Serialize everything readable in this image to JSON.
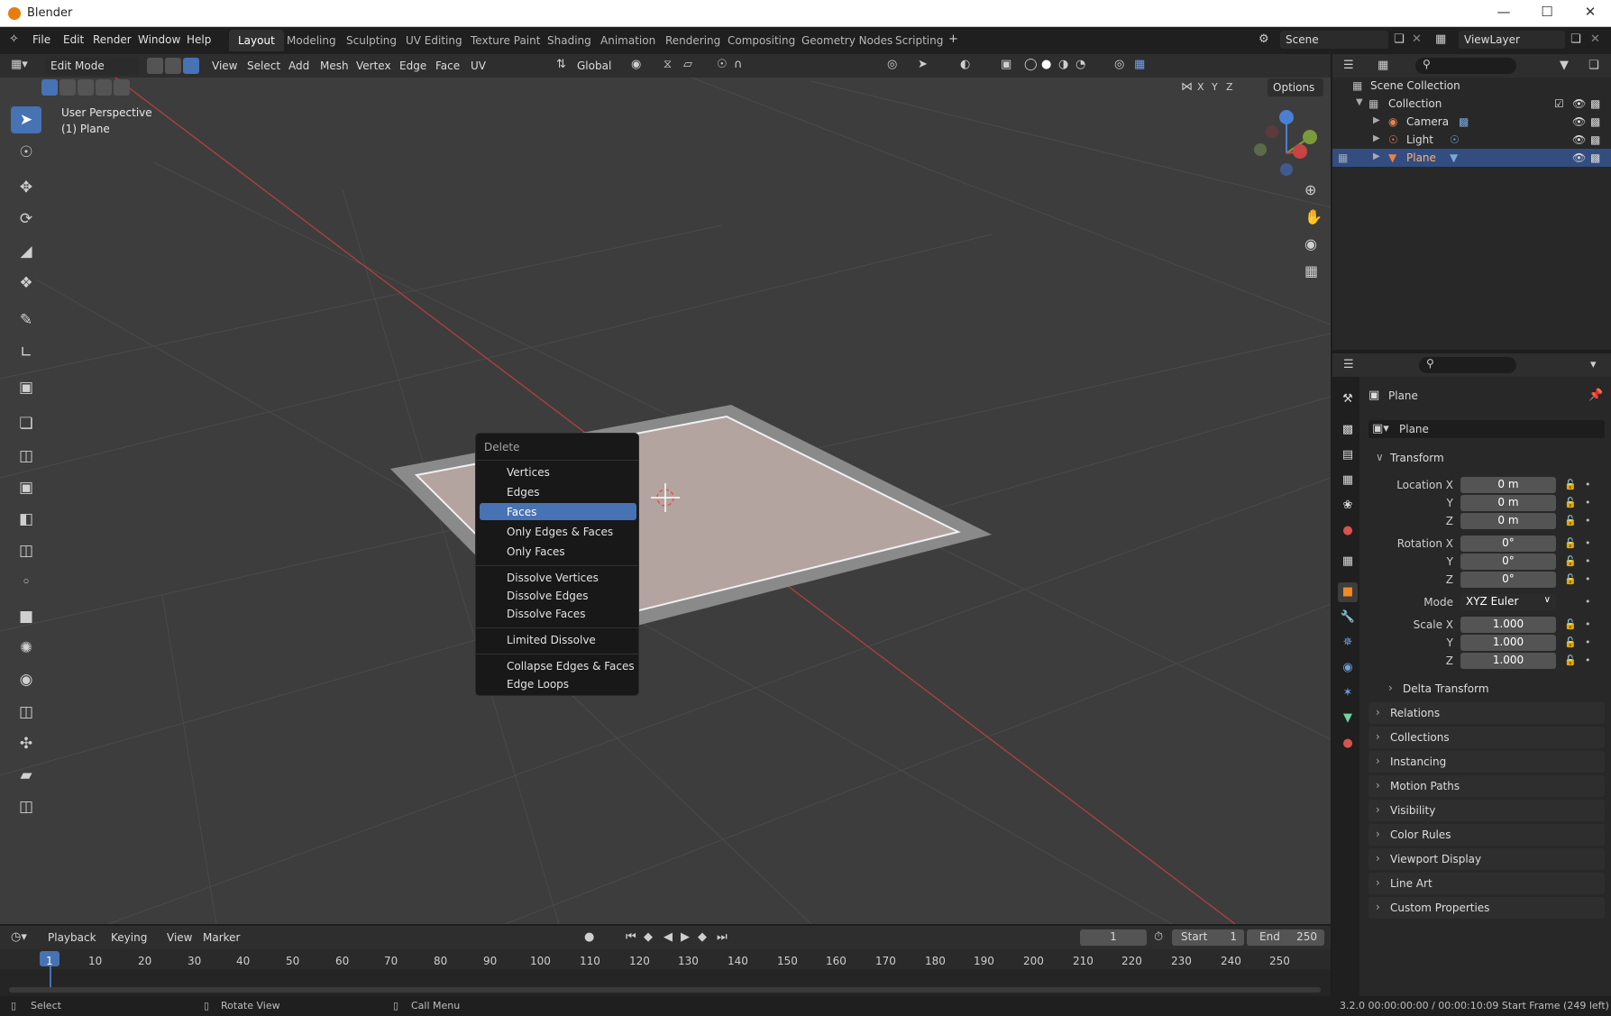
{
  "window": {
    "title": "Blender"
  },
  "menu": [
    "File",
    "Edit",
    "Render",
    "Window",
    "Help"
  ],
  "workspaces": [
    "Layout",
    "Modeling",
    "Sculpting",
    "UV Editing",
    "Texture Paint",
    "Shading",
    "Animation",
    "Rendering",
    "Compositing",
    "Geometry Nodes",
    "Scripting"
  ],
  "scene_label": "Scene",
  "viewlayer_label": "ViewLayer",
  "viewport": {
    "mode": "Edit Mode",
    "menus": [
      "View",
      "Select",
      "Add",
      "Mesh",
      "Vertex",
      "Edge",
      "Face",
      "UV"
    ],
    "orientation": "Global",
    "options_label": "Options",
    "axis_toggles": [
      "X",
      "Y",
      "Z"
    ],
    "perspective_label": "User Perspective",
    "object_label": "(1) Plane"
  },
  "delete_menu": {
    "title": "Delete",
    "groups": [
      [
        "Vertices",
        "Edges",
        "Faces",
        "Only Edges & Faces",
        "Only Faces"
      ],
      [
        "Dissolve Vertices",
        "Dissolve Edges",
        "Dissolve Faces"
      ],
      [
        "Limited Dissolve"
      ],
      [
        "Collapse Edges & Faces",
        "Edge Loops"
      ]
    ],
    "highlighted": "Faces"
  },
  "outliner": {
    "scene_collection": "Scene Collection",
    "collection": "Collection",
    "items": [
      "Camera",
      "Light",
      "Plane"
    ],
    "selected": "Plane"
  },
  "properties": {
    "object_name": "Plane",
    "data_name": "Plane",
    "transform_title": "Transform",
    "location_label": "Location X",
    "rotation_label": "Rotation X",
    "scale_label": "Scale X",
    "axis_y": "Y",
    "axis_z": "Z",
    "location": [
      "0 m",
      "0 m",
      "0 m"
    ],
    "rotation": [
      "0°",
      "0°",
      "0°"
    ],
    "mode_label": "Mode",
    "mode_value": "XYZ Euler",
    "scale": [
      "1.000",
      "1.000",
      "1.000"
    ],
    "delta_transform": "Delta Transform",
    "panels": [
      "Relations",
      "Collections",
      "Instancing",
      "Motion Paths",
      "Visibility",
      "Color Rules",
      "Viewport Display",
      "Line Art",
      "Custom Properties"
    ]
  },
  "timeline": {
    "menus": [
      "Playback",
      "Keying",
      "View",
      "Marker"
    ],
    "current_frame": "1",
    "start_label": "Start",
    "start_value": "1",
    "end_label": "End",
    "end_value": "250",
    "ticks": [
      "1",
      "10",
      "20",
      "30",
      "40",
      "50",
      "60",
      "70",
      "80",
      "90",
      "100",
      "110",
      "120",
      "130",
      "140",
      "150",
      "160",
      "170",
      "180",
      "190",
      "200",
      "210",
      "220",
      "230",
      "240",
      "250"
    ]
  },
  "statusbar": {
    "select": "Select",
    "rotate": "Rotate View",
    "call_menu": "Call Menu",
    "info": "3.2.0  00:00:00:00 / 00:00:10:09  Start Frame (249 left)"
  },
  "colors": {
    "accent": "#4772b3",
    "selection_row": "#334d80",
    "x_axis": "#c84444",
    "background": "#3d3d3d"
  }
}
